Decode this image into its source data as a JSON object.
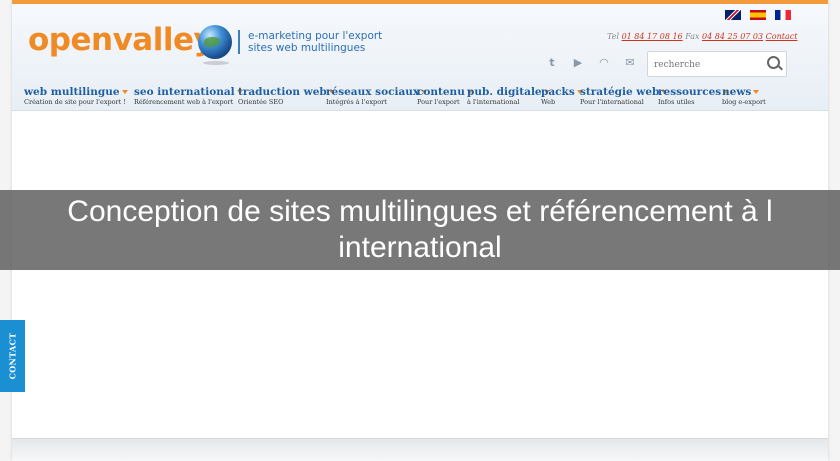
{
  "logo": {
    "text": "openvalley"
  },
  "tagline": {
    "line1": "e-marketing pour l'export",
    "line2": "sites web multilingues"
  },
  "flags": [
    "flag-uk-icon",
    "flag-es-icon",
    "flag-fr-icon"
  ],
  "contact_info": {
    "tel_label": "Tel",
    "tel_number": "01 84 17 08 16",
    "fax_label": "Fax",
    "fax_number": "04 84 25 07 03",
    "contact_link": "Contact"
  },
  "social": [
    "twitter-icon",
    "youtube-icon",
    "rss-icon",
    "email-icon"
  ],
  "search": {
    "placeholder": "recherche"
  },
  "nav": {
    "items": [
      {
        "title": "web multilingue",
        "sub": "Création de site pour l'export !"
      },
      {
        "title": "seo international",
        "sub": "Référencement web à l'export"
      },
      {
        "title": "traduction web",
        "sub": "Orientée SEO"
      },
      {
        "title": "réseaux sociaux",
        "sub": "Intégrés à l'export"
      },
      {
        "title": "contenu",
        "sub": "Pour l'export"
      },
      {
        "title": "pub. digitale",
        "sub": "à l'international"
      },
      {
        "title": "packs",
        "sub": "Web"
      },
      {
        "title": "stratégie web",
        "sub": "Pour l'international"
      },
      {
        "title": "ressources",
        "sub": "Infos utiles"
      },
      {
        "title": "news",
        "sub": "blog e-export"
      }
    ]
  },
  "banner": {
    "text": "Conception de sites multilingues et référencement à l international"
  },
  "contact_tab": {
    "label": "CONTACT"
  },
  "colors": {
    "accent": "#f08a24",
    "nav_blue": "#1f5fa0",
    "contact_blue": "#1a8fd1"
  }
}
